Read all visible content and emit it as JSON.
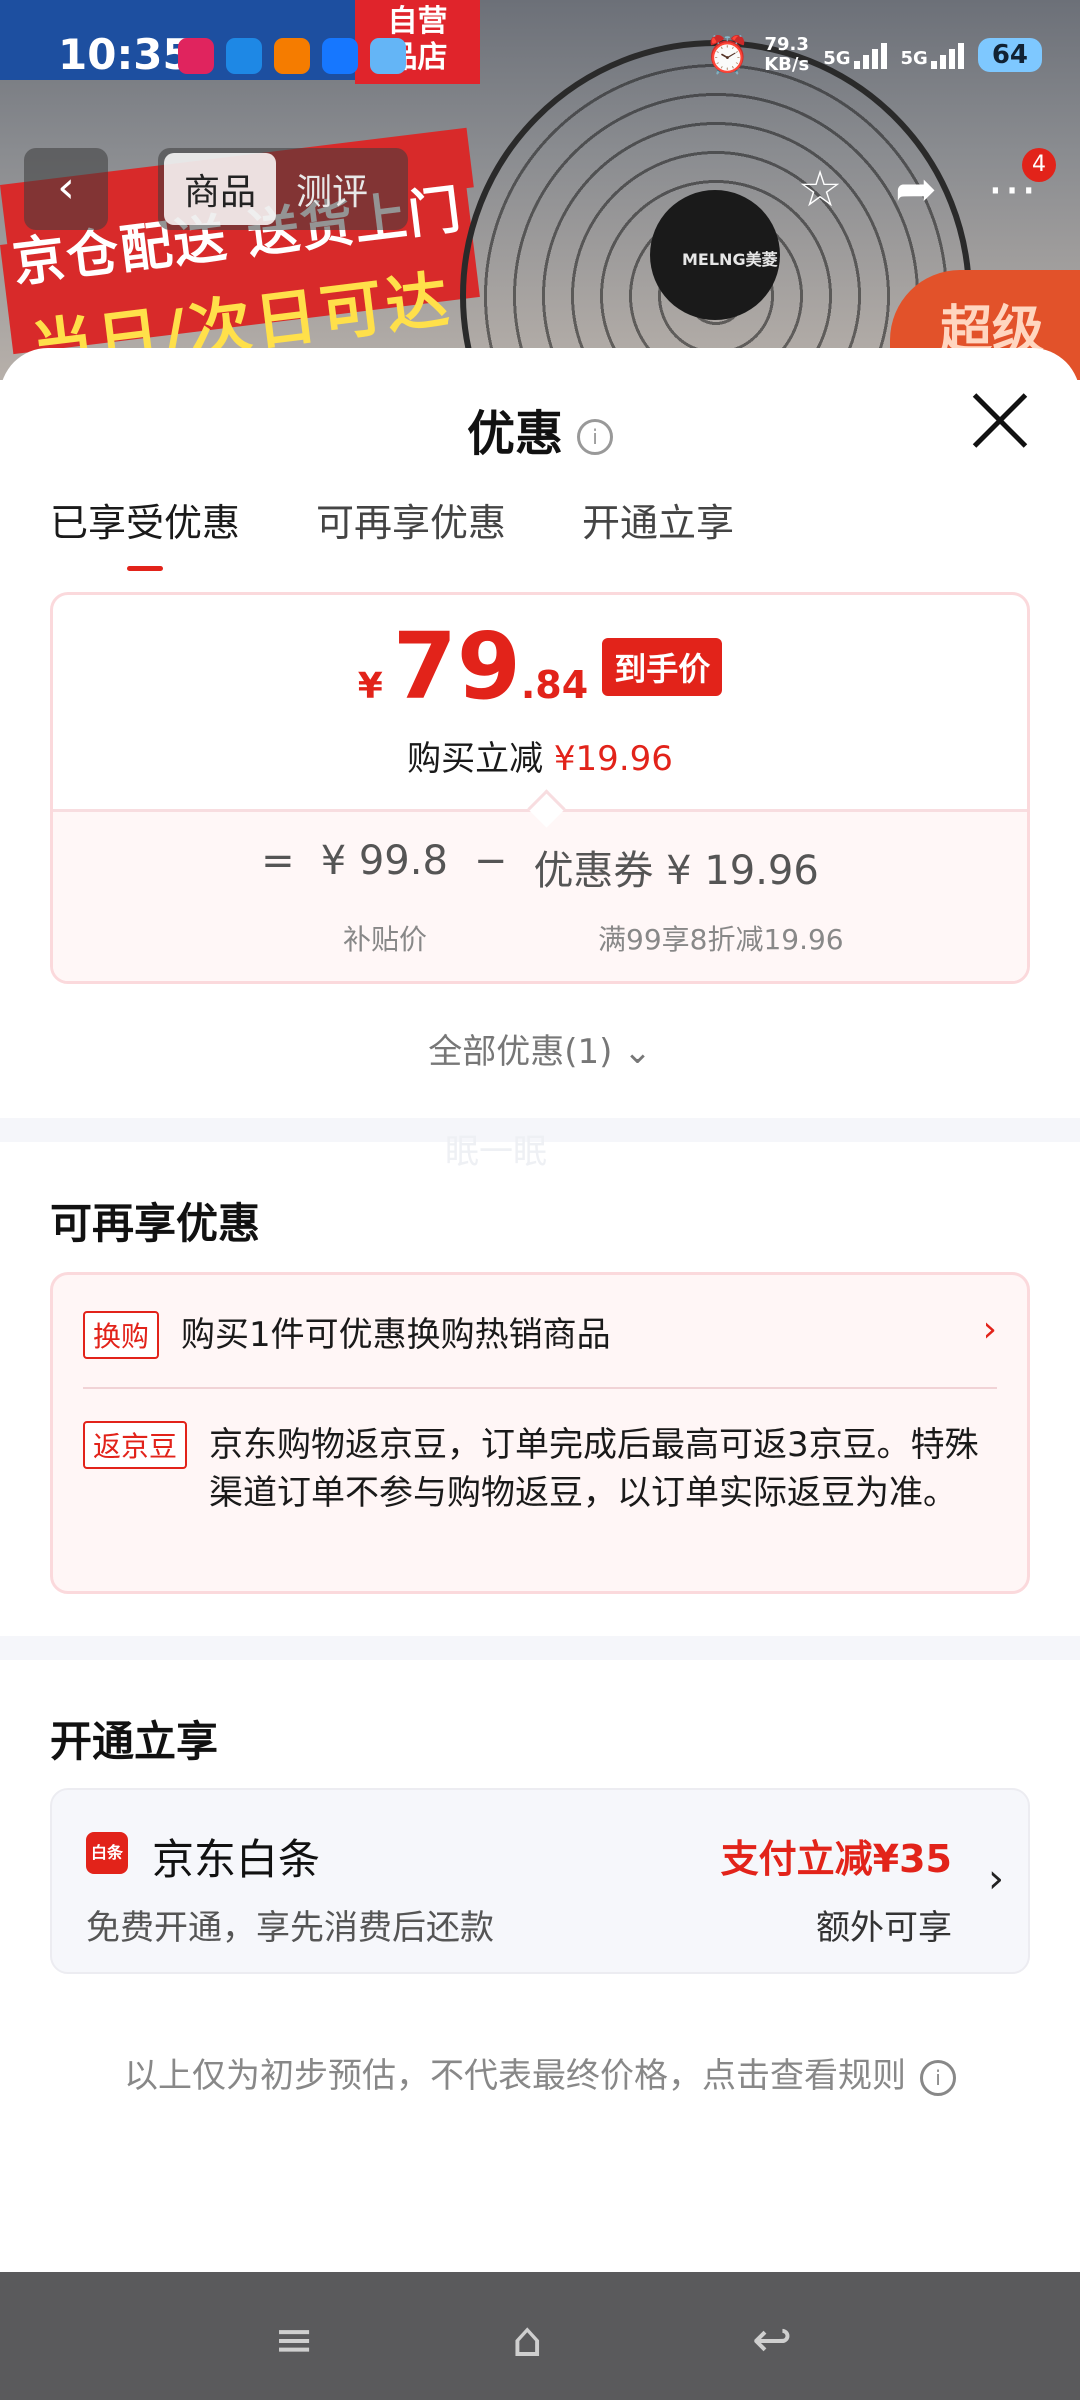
{
  "status_bar": {
    "time": "10:35",
    "net_speed_value": "79.3",
    "net_speed_unit": "KB/s",
    "sim1": "5G",
    "sim2": "5G",
    "battery": "64"
  },
  "background": {
    "store_label": "自营\n品店",
    "ad_line1": "京仓配送 送货上门",
    "ad_line2": "当日/次日可达",
    "fan_brand": "MELNG美菱",
    "corner_text": "超级"
  },
  "top_nav": {
    "back_icon": "chevron-left-icon",
    "tabs": [
      {
        "label": "商品",
        "active": true
      },
      {
        "label": "测评",
        "active": false
      }
    ],
    "badge_count": "4"
  },
  "sheet": {
    "title": "优惠",
    "tabs": [
      "已享受优惠",
      "可再享优惠",
      "开通立享"
    ],
    "active_tab": 0,
    "price": {
      "currency": "¥",
      "integer": "79",
      "decimal": ".84",
      "tag": "到手价",
      "save_label": "购买立减",
      "save_amount": "¥19.96"
    },
    "calc": {
      "eq": "=",
      "subsidy_price": "¥ 99.8",
      "minus": "−",
      "coupon": "优惠券 ¥ 19.96",
      "subsidy_label": "补贴价",
      "coupon_label": "满99享8折减19.96"
    },
    "all_discounts": "全部优惠(1)",
    "watermark": "眠一眠",
    "more_section": {
      "title": "可再享优惠",
      "items": [
        {
          "tag": "换购",
          "text": "购买1件可优惠换购热销商品"
        },
        {
          "tag": "返京豆",
          "text": "京东购物返京豆，订单完成后最高可返3京豆。特殊渠道订单不参与购物返豆，以订单实际返豆为准。"
        }
      ]
    },
    "open_section": {
      "title": "开通立享",
      "card": {
        "logo_text": "白条",
        "name": "京东白条",
        "desc": "免费开通，享先消费后还款",
        "promo": "支付立减¥35",
        "extra": "额外可享"
      }
    },
    "disclaimer": "以上仅为初步预估，不代表最终价格，点击查看规则"
  },
  "colors": {
    "accent": "#e2231a",
    "card_border": "#fbd9dc",
    "section_gap": "#f5f6fa"
  }
}
